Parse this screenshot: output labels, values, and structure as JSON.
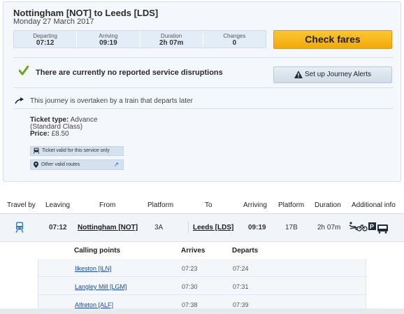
{
  "journey": {
    "title": "Nottingham [NOT] to Leeds [LDS]",
    "date": "Monday 27 March 2017"
  },
  "summary": {
    "departing_label": "Departing",
    "departing_value": "07:12",
    "arriving_label": "Arriving",
    "arriving_value": "09:19",
    "duration_label": "Duration",
    "duration_value": "2h 07m",
    "changes_label": "Changes",
    "changes_value": "0"
  },
  "actions": {
    "check_fares": "Check fares",
    "journey_alerts": "Set up Journey Alerts"
  },
  "status": {
    "disruption": "There are currently no reported service disruptions",
    "overtaken": "This journey is overtaken by a train that departs later"
  },
  "ticket": {
    "type_label": "Ticket type:",
    "type_value": "Advance (Standard Class)",
    "price_label": "Price:",
    "price_value": "£8.50",
    "valid_service": "Ticket valid for this service only",
    "other_routes": "Other valid routes"
  },
  "table": {
    "headers": {
      "travel_by": "Travel by",
      "leaving": "Leaving",
      "from": "From",
      "platform": "Platform",
      "to": "To",
      "arriving": "Arriving",
      "platform2": "Platform",
      "duration": "Duration",
      "additional": "Additional info"
    },
    "row": {
      "leaving": "07:12",
      "from": "Nottingham [NOT]",
      "platform": "3A",
      "to": "Leeds [LDS]",
      "arriving": "09:19",
      "platform2": "17B",
      "duration": "2h 07m"
    }
  },
  "calling": {
    "header_points": "Calling points",
    "header_arrives": "Arrives",
    "header_departs": "Departs",
    "rows": [
      {
        "station": "Ilkeston [ILN]",
        "arrives": "07:23",
        "departs": "07:24"
      },
      {
        "station": "Langley Mill [LGM]",
        "arrives": "07:30",
        "departs": "07:31"
      },
      {
        "station": "Alfreton [ALF]",
        "arrives": "07:38",
        "departs": "07:39"
      }
    ]
  },
  "colors": {
    "accent_yellow": "#f2a90c",
    "check_green": "#6aa516",
    "link_blue": "#1f4c8a",
    "train_icon_blue": "#2f7fc4"
  }
}
